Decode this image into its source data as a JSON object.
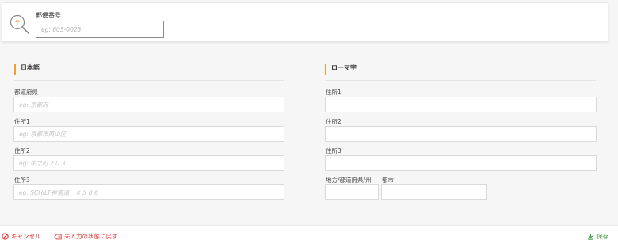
{
  "postal": {
    "label": "郵便番号",
    "placeholder": "eg: 605-0023",
    "icon_badge": "〒"
  },
  "japanese": {
    "title": "日本語",
    "fields": [
      {
        "label": "都道府県",
        "placeholder": "eg: 京都府"
      },
      {
        "label": "住所1",
        "placeholder": "eg: 京都市東山区"
      },
      {
        "label": "住所2",
        "placeholder": "eg: 中之町２０３"
      },
      {
        "label": "住所3",
        "placeholder": "eg: SCHILF神宮道　＃５０６"
      }
    ]
  },
  "romaji": {
    "title": "ローマ字",
    "fields": [
      {
        "label": "住所1",
        "placeholder": ""
      },
      {
        "label": "住所2",
        "placeholder": ""
      },
      {
        "label": "住所3",
        "placeholder": ""
      }
    ],
    "region_label": "地方/都道府県/州",
    "city_label": "都市"
  },
  "footer": {
    "cancel_label": "キャンセル",
    "reset_label": "未入力の状態に戻す",
    "save_label": "保存"
  },
  "colors": {
    "accent": "#f0a030",
    "danger": "#e53935",
    "success": "#43a047"
  }
}
